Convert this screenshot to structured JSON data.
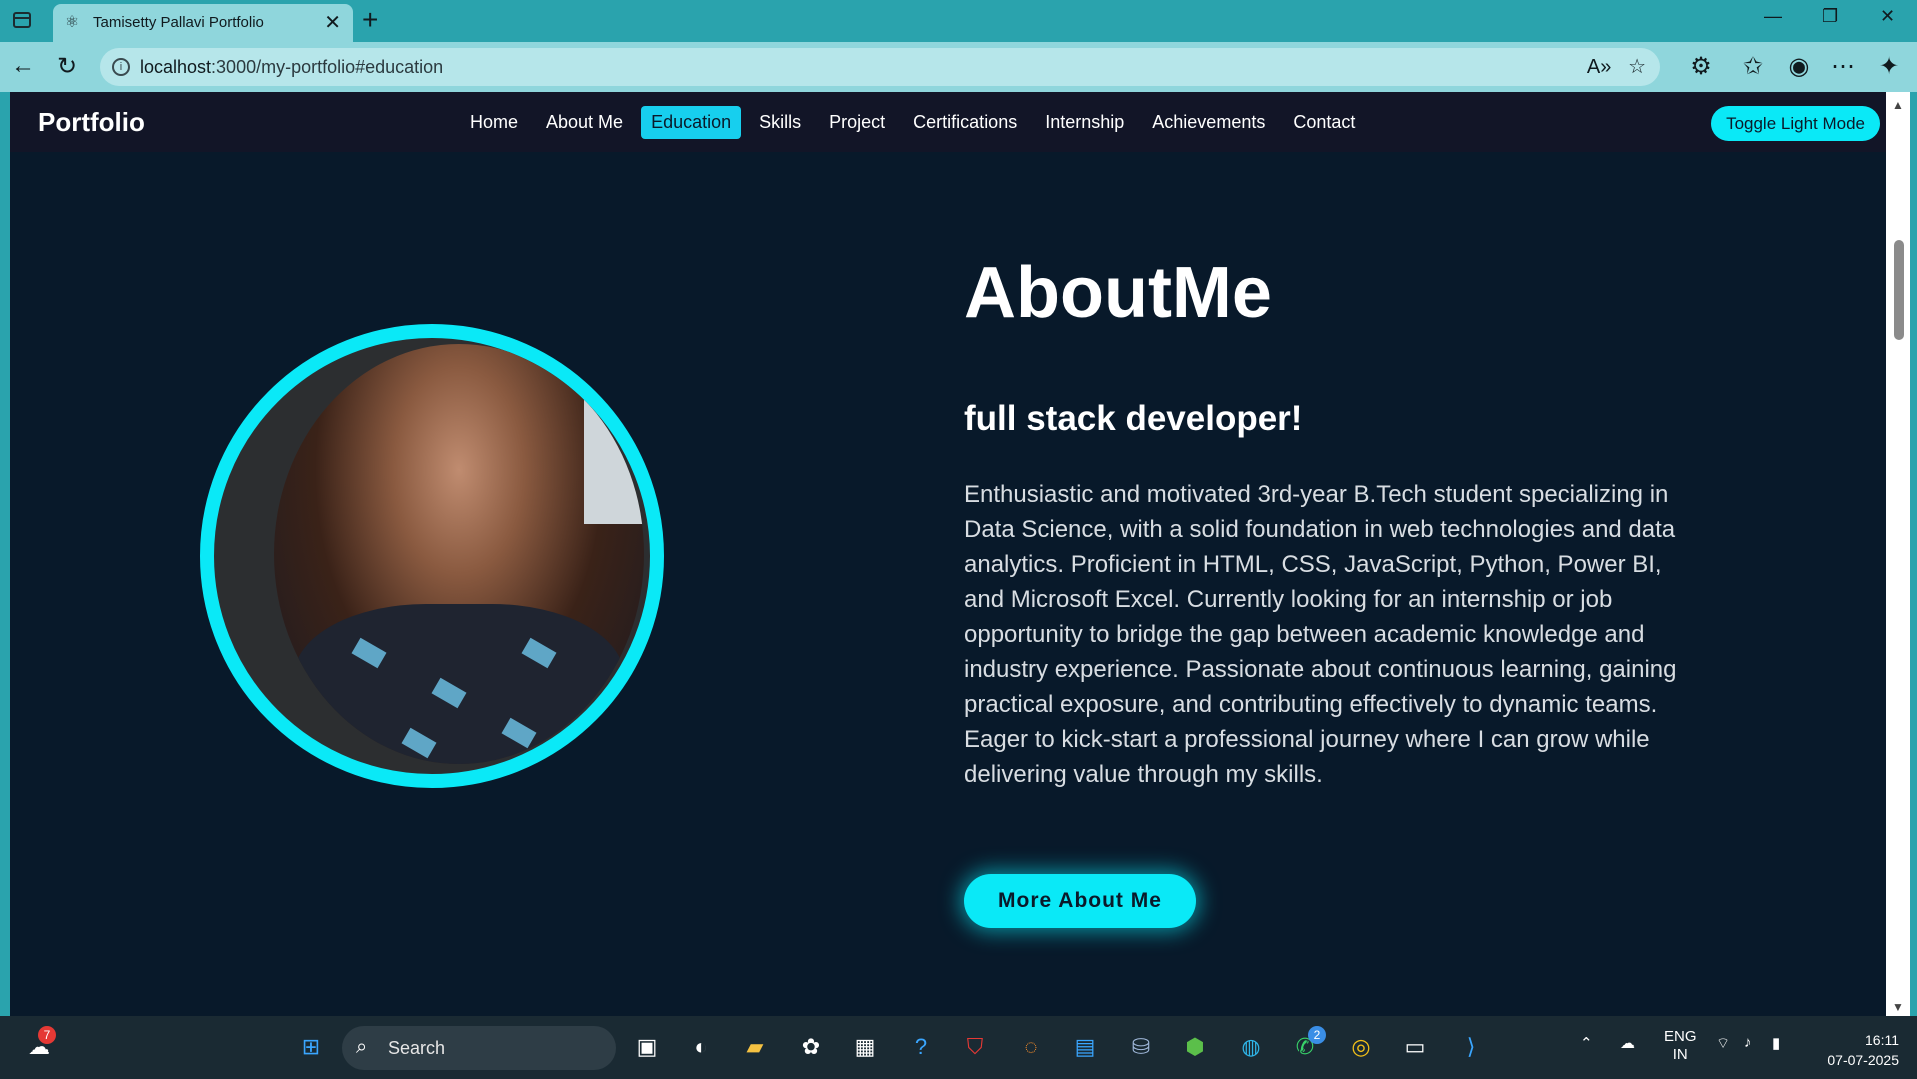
{
  "browser": {
    "tab_title": "Tamisetty Pallavi Portfolio",
    "url_host": "localhost",
    "url_path": ":3000/my-portfolio#education"
  },
  "site": {
    "brand": "Portfolio",
    "nav": [
      {
        "label": "Home",
        "active": false
      },
      {
        "label": "About Me",
        "active": false
      },
      {
        "label": "Education",
        "active": true
      },
      {
        "label": "Skills",
        "active": false
      },
      {
        "label": "Project",
        "active": false
      },
      {
        "label": "Certifications",
        "active": false
      },
      {
        "label": "Internship",
        "active": false
      },
      {
        "label": "Achievements",
        "active": false
      },
      {
        "label": "Contact",
        "active": false
      }
    ],
    "toggle_label": "Toggle Light Mode"
  },
  "about": {
    "title": "AboutMe",
    "subtitle": "full stack developer!",
    "body": "Enthusiastic and motivated 3rd-year B.Tech student specializing in Data Science, with a solid foundation in web technologies and data analytics. Proficient in HTML, CSS, JavaScript, Python, Power BI, and Microsoft Excel. Currently looking for an internship or job opportunity to bridge the gap between academic knowledge and industry experience. Passionate about continuous learning, gaining practical exposure, and contributing effectively to dynamic teams. Eager to kick-start a professional journey where I can grow while delivering value through my skills.",
    "button": "More About Me"
  },
  "taskbar": {
    "search_label": "Search",
    "weather_badge": "7",
    "whatsapp_badge": "2",
    "lang_top": "ENG",
    "lang_bottom": "IN",
    "time": "16:11",
    "date": "07-07-2025"
  },
  "colors": {
    "accent": "#0ae9f7",
    "page_bg": "#08192a",
    "nav_bg": "#121527",
    "browser_frame": "#2aa3ad"
  }
}
